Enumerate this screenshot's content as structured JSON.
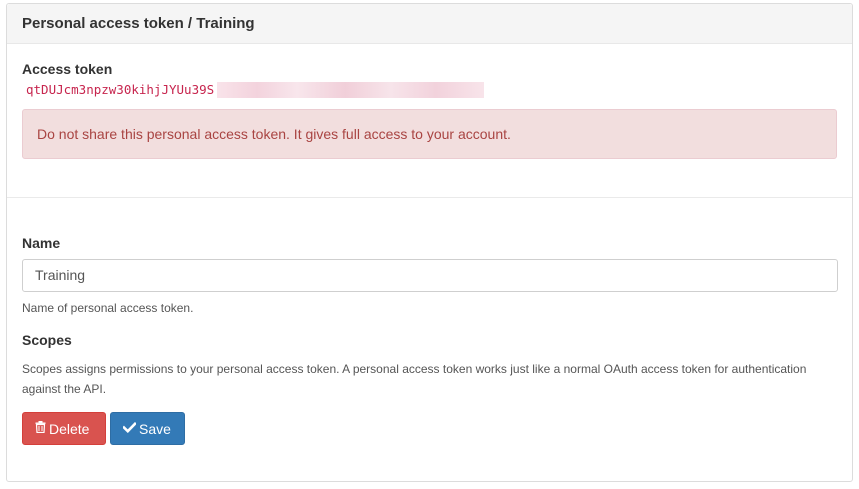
{
  "panel": {
    "title": "Personal access token / Training"
  },
  "token_section": {
    "label": "Access token",
    "token_visible": "qtDUJcm3npzw30kihjJYUu39S",
    "warning": "Do not share this personal access token. It gives full access to your account."
  },
  "form": {
    "name_label": "Name",
    "name_value": "Training",
    "name_help": "Name of personal access token.",
    "scopes_label": "Scopes",
    "scopes_help": "Scopes assigns permissions to your personal access token. A personal access token works just like a normal OAuth access token for authentication against the API."
  },
  "buttons": {
    "delete_label": "Delete",
    "delete_icon": "trash-icon",
    "save_label": "Save",
    "save_icon": "check-icon"
  },
  "colors": {
    "danger": "#d9534f",
    "primary": "#337ab7",
    "token": "#c7254e",
    "alert_bg": "#f2dede",
    "alert_text": "#a94442"
  }
}
